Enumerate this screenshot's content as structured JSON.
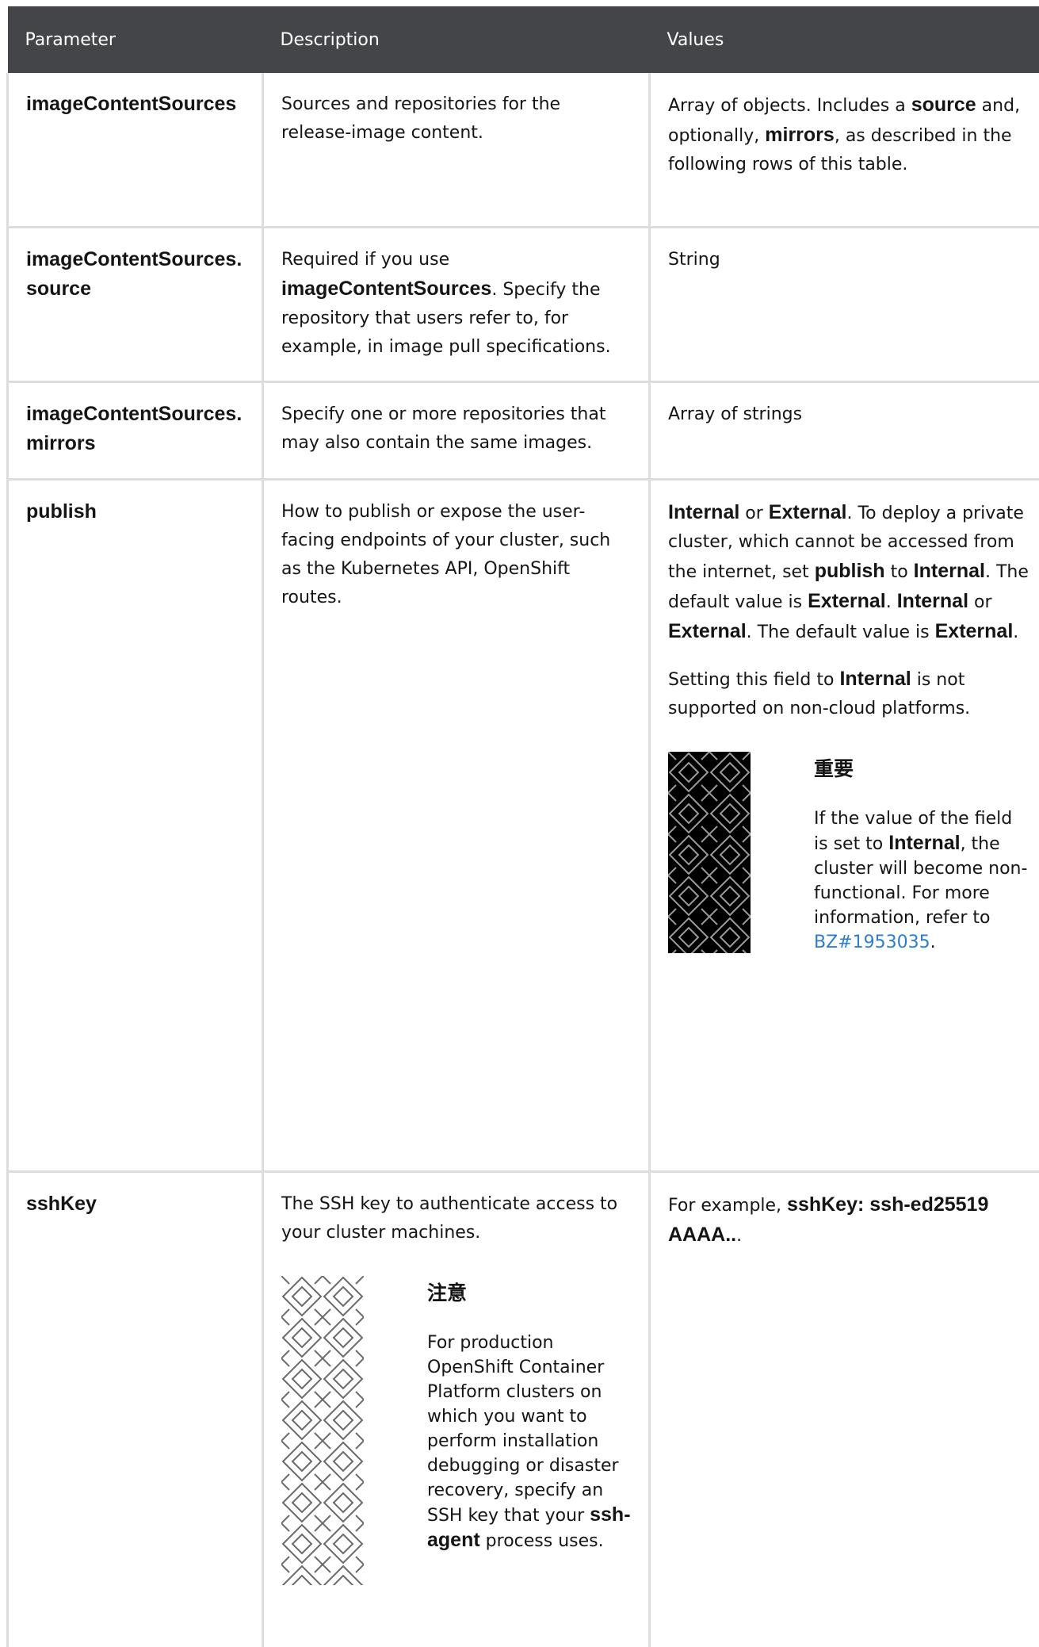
{
  "header": {
    "col1": "Parameter",
    "col2": "Description",
    "col3": "Values"
  },
  "rows": [
    {
      "param": "imageContentSources",
      "desc": "Sources and repositories for the release-image content.",
      "values": {
        "t1": "Array of objects. Includes a ",
        "k1": "source",
        "t2": " and, optionally, ",
        "k2": "mirrors",
        "t3": ", as described in the following rows of this table."
      }
    },
    {
      "param": "imageContentSources.source",
      "desc": {
        "t1": "Required if you use ",
        "k1": "imageContentSources",
        "t2": ". Specify the repository that users refer to, for example, in image pull specifications."
      },
      "values": "String"
    },
    {
      "param": "imageContentSources.mirrors",
      "desc": "Specify one or more repositories that may also contain the same images.",
      "values": "Array of strings"
    },
    {
      "param": "publish",
      "desc": "How to publish or expose the user-facing endpoints of your cluster, such as the Kubernetes API, OpenShift routes.",
      "values": {
        "p1": {
          "k1": "Internal",
          "t1": " or ",
          "k2": "External",
          "t2": ". To deploy a private cluster, which cannot be accessed from the internet, set ",
          "k3": "publish",
          "t3": " to ",
          "k4": "Internal",
          "t4": ". The default value is ",
          "k5": "External",
          "t5": ". ",
          "k6": "Internal",
          "t6": " or ",
          "k7": "External",
          "t7": ". The default value is ",
          "k8": "External",
          "t8": "."
        },
        "p2": {
          "t1": "Setting this field to ",
          "k1": "Internal",
          "t2": " is not supported on non-cloud platforms."
        },
        "admonition": {
          "title": "重要",
          "t1": "If the value of the field is set to ",
          "k1": "Internal",
          "t2": ", the cluster will become non-functional. For more information, refer to ",
          "link": "BZ#1953035",
          "t3": "."
        }
      }
    },
    {
      "param": "sshKey",
      "desc": {
        "text": "The SSH key to authenticate access to your cluster machines.",
        "admonition": {
          "title": "注意",
          "t1": "For production OpenShift Container Platform clusters on which you want to perform installation debugging or disaster recovery, specify an SSH key that your ",
          "k1": "ssh-agent",
          "t2": " process uses."
        }
      },
      "values": {
        "t1": "For example, ",
        "k1": "sshKey: ssh-ed25519 AAAA..",
        "t2": "."
      }
    }
  ],
  "colors": {
    "header_bg": "#444548",
    "border": "#dddddd",
    "link": "#2b7cd3",
    "important_icon_bg": "#000000"
  },
  "icons": {
    "important": "important-pattern-icon",
    "note": "note-pattern-icon"
  }
}
